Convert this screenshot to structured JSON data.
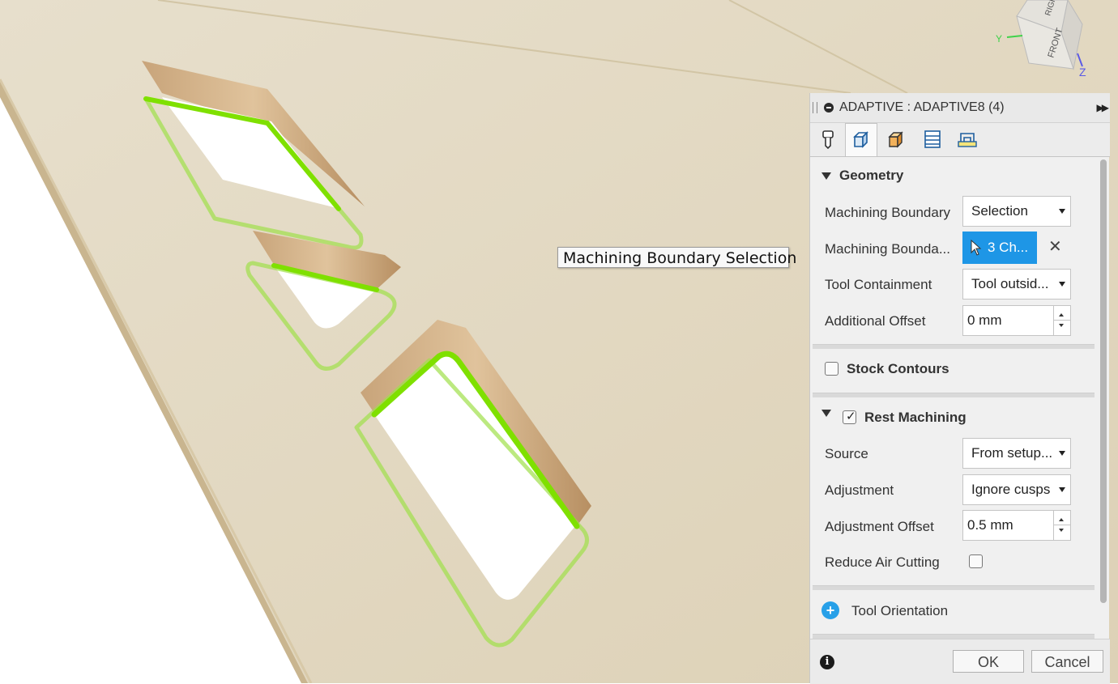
{
  "tooltip": {
    "text": "Machining Boundary Selection"
  },
  "panel": {
    "title": "ADAPTIVE : ADAPTIVE8 (4)",
    "tabs": [
      {
        "icon": "tool-icon"
      },
      {
        "icon": "geometry-icon"
      },
      {
        "icon": "heights-icon"
      },
      {
        "icon": "passes-icon"
      },
      {
        "icon": "linking-icon"
      }
    ],
    "geometry": {
      "heading": "Geometry",
      "boundary_label": "Machining Boundary",
      "boundary_value": "Selection",
      "selection_label": "Machining Bounda...",
      "selection_value": "3 Ch...",
      "containment_label": "Tool Containment",
      "containment_value": "Tool outsid...",
      "offset_label": "Additional Offset",
      "offset_value": "0 mm"
    },
    "stock_contours": {
      "label": "Stock Contours",
      "checked": false
    },
    "rest_machining": {
      "heading": "Rest Machining",
      "checked": true,
      "checkmark": "✓",
      "source_label": "Source",
      "source_value": "From setup...",
      "adjustment_label": "Adjustment",
      "adjustment_value": "Ignore cusps",
      "adj_offset_label": "Adjustment Offset",
      "adj_offset_value": "0.5 mm",
      "reduce_label": "Reduce Air Cutting",
      "reduce_checked": false
    },
    "tool_orientation": {
      "label": "Tool Orientation"
    },
    "footer": {
      "ok_label": "OK",
      "cancel_label": "Cancel"
    }
  },
  "viewcube": {
    "front_label": "FRONT",
    "right_label": "RIGHT",
    "axis_y": "Y",
    "axis_z": "Z"
  },
  "colors": {
    "accent": "#1e96e6",
    "highlight": "#7fe000",
    "wood": "#e6dcc6"
  }
}
